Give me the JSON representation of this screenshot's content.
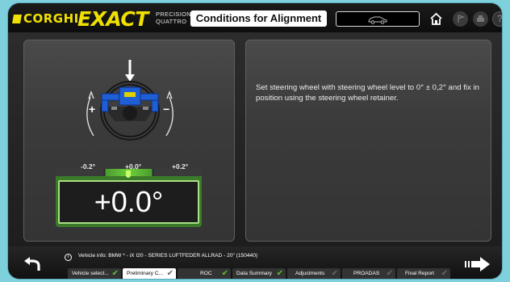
{
  "header": {
    "brand": "CORGHI",
    "product": "EXACT",
    "product_sub_1": "PRECISION",
    "product_sub_2": "QUATTRO",
    "title": "Conditions for Alignment"
  },
  "icons": {
    "vehicle": "car-icon",
    "home": "home-icon",
    "flag": "flag-icon",
    "print": "print-icon",
    "help": "help-icon",
    "help_glyph": "?"
  },
  "left_panel": {
    "plus_label": "+",
    "minus_label": "−",
    "scale_left": "-0.2°",
    "scale_center": "+0.0°",
    "scale_right": "+0.2°",
    "readout": "+0.0°"
  },
  "right_panel": {
    "instruction": "Set steering wheel with steering wheel level to 0° ± 0,2° and fix in position using the steering wheel retainer."
  },
  "footer": {
    "info_glyph": "i",
    "info_label": "Vehicle info:",
    "info_value": "BMW * - iX I20 - SERIES LUFTFEDER ALLRAD - 20\" (150440)",
    "steps": [
      {
        "label": "Vehicle select...",
        "state": "done"
      },
      {
        "label": "Preliminary C...",
        "state": "active"
      },
      {
        "label": "ROC",
        "state": "done"
      },
      {
        "label": "Data Summary",
        "state": "done"
      },
      {
        "label": "Adjustments",
        "state": "pending"
      },
      {
        "label": "PROADAS",
        "state": "pending"
      },
      {
        "label": "Final Report",
        "state": "pending"
      }
    ]
  },
  "colors": {
    "brand_yellow": "#f0e000",
    "ok_green": "#5ec42a",
    "steering_blue": "#1f5fd6"
  }
}
